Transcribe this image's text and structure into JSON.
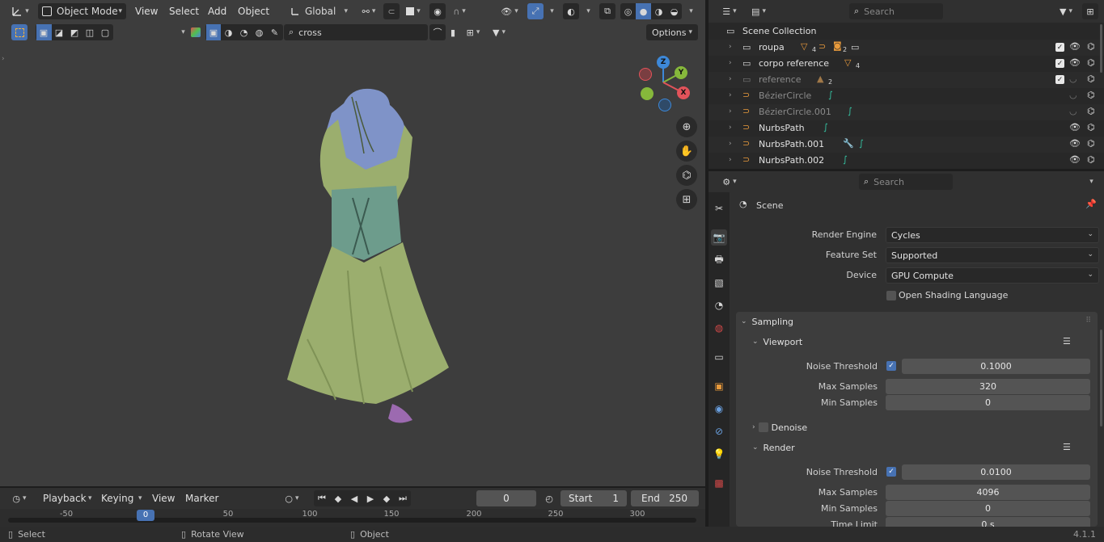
{
  "viewport": {
    "mode_label": "Object Mode",
    "menus": [
      "View",
      "Select",
      "Add",
      "Object"
    ],
    "transform_orientation": "Global",
    "search_value": "cross",
    "options_label": "Options"
  },
  "gizmo": {
    "x": "X",
    "y": "Y",
    "z": "Z"
  },
  "timeline": {
    "menus": [
      "Playback",
      "Keying",
      "View",
      "Marker"
    ],
    "current_frame": "0",
    "start_label": "Start",
    "start_value": "1",
    "end_label": "End",
    "end_value": "250",
    "ruler_ticks": [
      "-50",
      "0",
      "50",
      "100",
      "150",
      "200",
      "250",
      "300"
    ],
    "playhead_frame": "0"
  },
  "statusbar": {
    "items": [
      "Select",
      "Rotate View",
      "Object"
    ],
    "version": "4.1.1"
  },
  "outliner": {
    "search_placeholder": "Search",
    "root": "Scene Collection",
    "rows": [
      {
        "name": "roupa",
        "badge": "4",
        "badge2": "2"
      },
      {
        "name": "corpo reference",
        "badge": "4"
      },
      {
        "name": "reference",
        "badge": "2"
      },
      {
        "name": "BézierCircle"
      },
      {
        "name": "BézierCircle.001"
      },
      {
        "name": "NurbsPath"
      },
      {
        "name": "NurbsPath.001"
      },
      {
        "name": "NurbsPath.002"
      }
    ]
  },
  "properties": {
    "search_placeholder": "Search",
    "scene_label": "Scene",
    "render_engine_label": "Render Engine",
    "render_engine_value": "Cycles",
    "feature_set_label": "Feature Set",
    "feature_set_value": "Supported",
    "device_label": "Device",
    "device_value": "GPU Compute",
    "osl_label": "Open Shading Language",
    "sampling_label": "Sampling",
    "viewport_label": "Viewport",
    "vp_noise_label": "Noise Threshold",
    "vp_noise_value": "0.1000",
    "vp_max_label": "Max Samples",
    "vp_max_value": "320",
    "vp_min_label": "Min Samples",
    "vp_min_value": "0",
    "denoise_label": "Denoise",
    "render_label": "Render",
    "r_noise_label": "Noise Threshold",
    "r_noise_value": "0.0100",
    "r_max_label": "Max Samples",
    "r_max_value": "4096",
    "r_min_label": "Min Samples",
    "r_min_value": "0",
    "time_limit_label": "Time Limit",
    "time_limit_value": "0 s"
  },
  "colors": {
    "accent": "#4772b3",
    "viewport_bg": "#3d3d3d",
    "axis_x": "#e2535a",
    "axis_y": "#86b83b",
    "axis_z": "#3d88d8"
  }
}
